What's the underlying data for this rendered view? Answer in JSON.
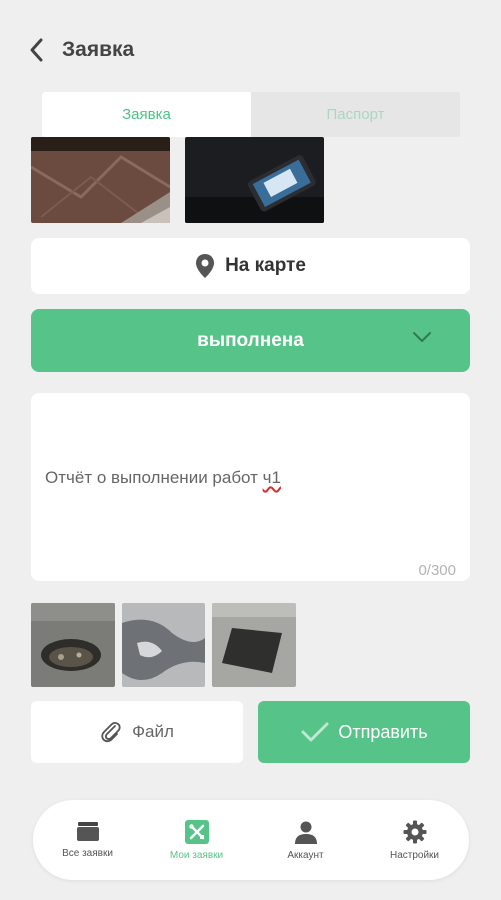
{
  "header": {
    "title": "Заявка",
    "back_icon": "chevron-left-icon"
  },
  "tabs": [
    {
      "label": "Заявка",
      "active": true
    },
    {
      "label": "Паспорт",
      "active": false
    }
  ],
  "map_button": {
    "label": "На карте",
    "icon": "map-pin-icon"
  },
  "status_select": {
    "value": "выполнена",
    "icon": "chevron-down-icon"
  },
  "report": {
    "text_before": "Отчёт о выполнении работ ",
    "text_misspelled": "ч1",
    "counter": "0/300"
  },
  "file_button": {
    "label": "Файл",
    "icon": "paperclip-icon"
  },
  "send_button": {
    "label": "Отправить",
    "icon": "check-icon"
  },
  "bottom_nav": [
    {
      "label": "Все заявки",
      "icon": "folder-icon",
      "active": false
    },
    {
      "label": "Мои заявки",
      "icon": "tools-icon",
      "active": true
    },
    {
      "label": "Аккаунт",
      "icon": "user-icon",
      "active": false
    },
    {
      "label": "Настройки",
      "icon": "gear-icon",
      "active": false
    }
  ],
  "colors": {
    "accent": "#56c489",
    "background": "#efefef",
    "error_underline": "#d32f2f"
  }
}
